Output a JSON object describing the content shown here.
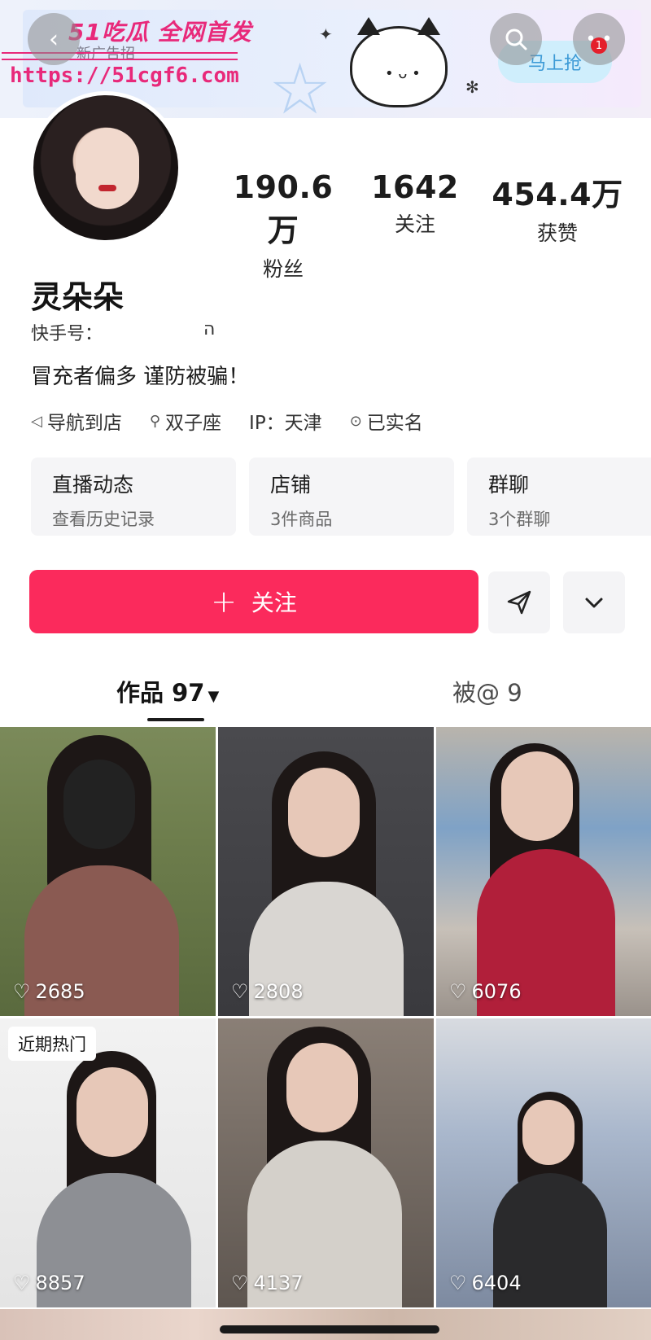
{
  "header": {
    "watermark_title": "51吃瓜 全网首发",
    "watermark_sub": "新广告招",
    "watermark_url": "https://51cgf6.com",
    "grab_button": "马上抢",
    "notification_count": "1"
  },
  "stats": [
    {
      "value": "190.6万",
      "label": "粉丝"
    },
    {
      "value": "1642",
      "label": "关注"
    },
    {
      "value": "454.4万",
      "label": "获赞"
    }
  ],
  "profile": {
    "name": "灵朵朵",
    "kuaishou_id_label": "快手号：",
    "kuaishou_id_value": "ה",
    "bio": "冒充者偏多 谨防被骗！"
  },
  "tags": [
    {
      "icon": "navigate-icon",
      "glyph": "◁",
      "label": "导航到店"
    },
    {
      "icon": "search-small-icon",
      "glyph": "⚲",
      "label": "双子座"
    },
    {
      "icon": "",
      "glyph": "",
      "label": "IP：天津"
    },
    {
      "icon": "verified-icon",
      "glyph": "⊙",
      "label": "已实名"
    }
  ],
  "cards": [
    {
      "title": "直播动态",
      "sub": "查看历史记录"
    },
    {
      "title": "店铺",
      "sub": "3件商品"
    },
    {
      "title": "群聊",
      "sub": "3个群聊"
    }
  ],
  "actions": {
    "follow_label": "关注",
    "follow_plus": "+"
  },
  "tabs": {
    "works": "作品 97",
    "mentioned": "被@ 9"
  },
  "grid": [
    {
      "likes": "2685",
      "badge": ""
    },
    {
      "likes": "2808",
      "badge": ""
    },
    {
      "likes": "6076",
      "badge": ""
    },
    {
      "likes": "8857",
      "badge": "近期热门"
    },
    {
      "likes": "4137",
      "badge": ""
    },
    {
      "likes": "6404",
      "badge": ""
    }
  ],
  "colors": {
    "accent": "#fb2a5c",
    "watermark": "#e8297a"
  }
}
